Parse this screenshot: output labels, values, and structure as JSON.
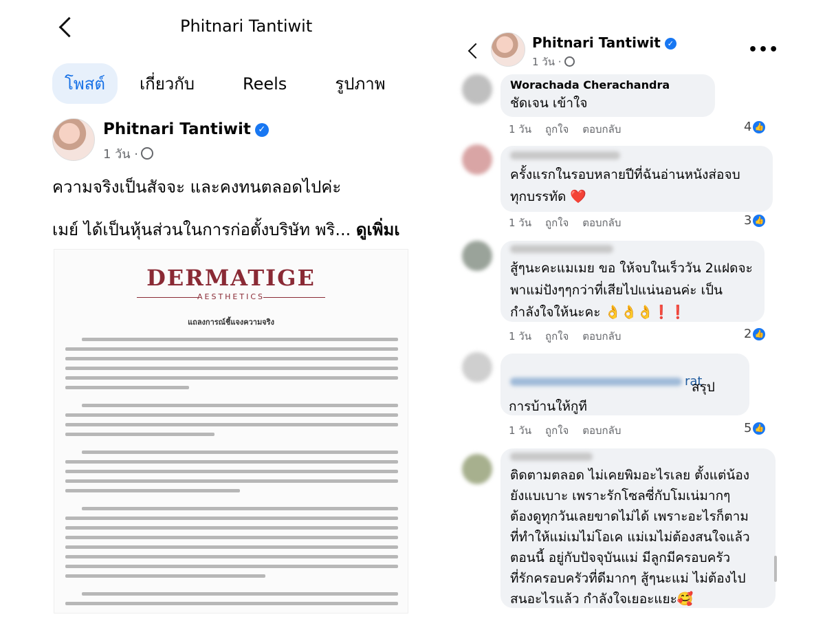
{
  "left": {
    "header": {
      "title": "Phitnari Tantiwit"
    },
    "tabs": [
      {
        "label": "โพสต์"
      },
      {
        "label": "เกี่ยวกับ"
      },
      {
        "label": "Reels"
      },
      {
        "label": "รูปภาพ"
      }
    ],
    "post": {
      "author": "Phitnari Tantiwit",
      "time": "1 วัน ·",
      "line1": "ความจริงเป็นสัจจะ และคงทนตลอดไปค่ะ",
      "line2": "เมย์ ได้เป็นหุ้นส่วนในการก่อตั้งบริษัท พริ...",
      "see_more": "ดูเพิ่มเ"
    },
    "document": {
      "brand": "DERMATIGE",
      "brand_sub": "AESTHETICS",
      "title": "แถลงการณ์ชี้แจงความจริง"
    }
  },
  "right": {
    "header": {
      "author": "Phitnari Tantiwit",
      "time": "1 วัน ·",
      "more": "•••"
    },
    "comments": [
      {
        "author": "Worachada Cherachandra",
        "text": "ชัดเจน เข้าใจ",
        "time": "1 วัน",
        "like": "ถูกใจ",
        "reply": "ตอบกลับ",
        "count": "4"
      },
      {
        "author": "",
        "text": "ครั้งแรกในรอบหลายปีที่ฉันอ่านหนังส่อจบ\nทุกบรรทัด ❤️",
        "time": "1 วัน",
        "like": "ถูกใจ",
        "reply": "ตอบกลับ",
        "count": "3"
      },
      {
        "author": "",
        "text": "สู้ๆนะคะแมเมย ขอ ให้จบในเร็ววัน 2แฝดจะ\nพาแม่ปังๆๆกว่าที่เสียไปแน่นอนค่ะ เป็น\nกำลังใจให้นะคะ 👌👌👌❗❗",
        "time": "1 วัน",
        "like": "ถูกใจ",
        "reply": "ตอบกลับ",
        "count": "2"
      },
      {
        "author": "",
        "name_tail": "rat",
        "text": "สรุป\nการบ้านให้กูที",
        "time": "1 วัน",
        "like": "ถูกใจ",
        "reply": "ตอบกลับ",
        "count": "5"
      },
      {
        "author": "",
        "text": "ติดตามตลอด ไม่เคยพิมอะไรเลย ตั้งแต่น้อง\nยังแบเบาะ เพราะรักโซลซี่กับโมเน่มากๆ\nต้องดูทุกวันเลยขาดไม่ได้ เพราะอะไรก็ตาม\nที่ทำให้แม่เมไม่โอเค แม่เมไม่ต้องสนใจแล้ว\nตอนนี้ อยู่กับปัจจุบันแม่ มีลูกมีครอบครัว\nที่รักครอบครัวที่ดีมากๆ สู้ๆนะแม่ ไม่ต้องไป\nสนอะไรแล้ว กำลังใจเยอะแยะ🥰"
      }
    ]
  }
}
